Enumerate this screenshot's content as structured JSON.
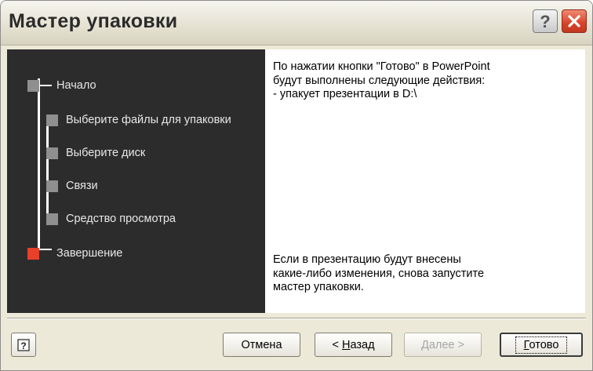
{
  "window": {
    "title": "Мастер упаковки",
    "help_icon": "help-icon",
    "close_icon": "close-icon"
  },
  "steps": [
    {
      "label": "Начало",
      "status": "inactive"
    },
    {
      "label": "Выберите файлы для упаковки",
      "status": "inactive"
    },
    {
      "label": "Выберите диск",
      "status": "inactive"
    },
    {
      "label": "Связи",
      "status": "inactive"
    },
    {
      "label": "Средство просмотра",
      "status": "inactive"
    },
    {
      "label": "Завершение",
      "status": "active"
    }
  ],
  "content": {
    "intro_lines": [
      "По нажатии кнопки \"Готово\" в PowerPoint",
      "будут выполнены следующие действия:",
      "- упакует презентации в D:\\"
    ],
    "footer_lines": [
      "Если в презентацию будут внесены",
      "какие-либо изменения, снова запустите",
      "мастер упаковки."
    ]
  },
  "buttons": {
    "cancel_label": "Отмена",
    "back_label_prefix": "< ",
    "back_label_key": "Н",
    "back_label_rest": "азад",
    "next_label_key": "Д",
    "next_label_rest": "алее >",
    "finish_label_key": "Г",
    "finish_label_rest": "отово"
  },
  "colors": {
    "panel_dark": "#2c2c2c",
    "step_inactive": "#8f8f8f",
    "step_active": "#e8402a",
    "dialog_bg": "#ece9d8"
  }
}
